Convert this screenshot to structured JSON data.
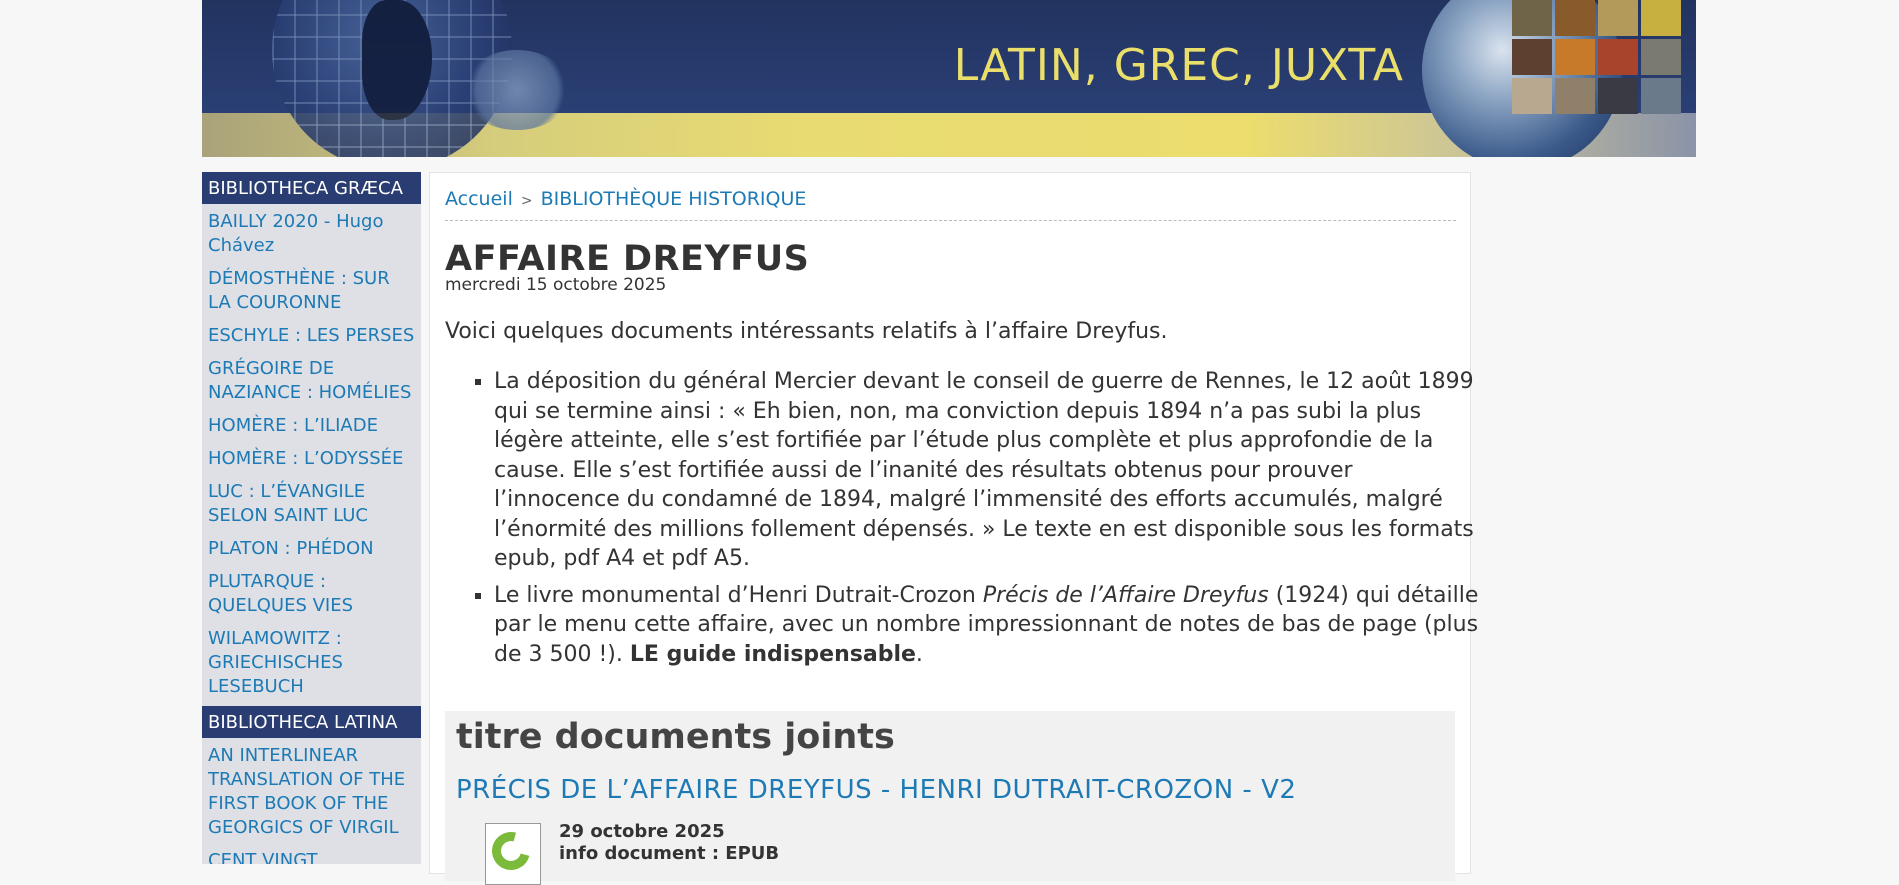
{
  "site": {
    "title": "LATIN, GREC, JUXTA"
  },
  "sidebar": {
    "sections": [
      {
        "heading": "BIBLIOTHECA GRÆCA",
        "items": [
          "BAILLY 2020 - Hugo Chávez",
          "DÉMOSTHÈNE : SUR LA COURONNE",
          "ESCHYLE : LES PERSES",
          "GRÉGOIRE DE NAZIANCE : HOMÉLIES",
          "HOMÈRE : L’ILIADE",
          "HOMÈRE : L’ODYSSÉE",
          "LUC : L’ÉVANGILE SELON SAINT LUC",
          "PLATON : PHÉDON",
          "PLUTARQUE : QUELQUES VIES",
          "WILAMOWITZ : GRIECHISCHES LESEBUCH"
        ]
      },
      {
        "heading": "BIBLIOTHECA LATINA",
        "items": [
          "AN INTERLINEAR TRANSLATION OF THE FIRST BOOK OF THE GEORGICS OF VIRGIL",
          "CENT VINGT VERSIONS"
        ]
      }
    ]
  },
  "breadcrumb": {
    "home": "Accueil",
    "section": "BIBLIOTHÈQUE HISTORIQUE"
  },
  "article": {
    "title": "AFFAIRE DREYFUS",
    "date": "mercredi 15 octobre 2025",
    "intro": "Voici quelques documents intéressants relatifs à l’affaire Dreyfus.",
    "item1": "La déposition du général Mercier devant le conseil de guerre de Rennes, le 12 août 1899 qui se termine ainsi : « Eh bien, non, ma conviction depuis 1894 n’a pas subi la plus légère atteinte, elle s’est fortifiée par l’étude plus complète et plus approfondie de la cause. Elle s’est fortifiée aussi de l’inanité des résultats obtenus pour prouver l’innocence du condamné de 1894, malgré l’immensité des efforts accumulés, malgré l’énormité des millions follement dépensés. » Le texte en est disponible sous les formats epub, pdf A4 et pdf A5.",
    "item2_before": "Le livre monumental d’Henri Dutrait-Crozon ",
    "item2_italic": "Précis de l’Affaire Dreyfus",
    "item2_middle": " (1924) qui détaille par le menu cette affaire, avec un nombre impressionnant de notes de bas de page (plus de 3 500 !). ",
    "item2_bold": "LE guide indispensable",
    "item2_end": "."
  },
  "attachments": {
    "heading": "titre documents joints",
    "doc_title": "PRÉCIS DE L’AFFAIRE DREYFUS - HENRI DUTRAIT-CROZON - V2",
    "doc_date": "29 octobre 2025",
    "doc_info": "info document : EPUB",
    "icon": "epub-icon"
  },
  "colors": {
    "banner_blue": "#2a3f75",
    "banner_yellow": "#eadf6a",
    "link_blue": "#1d7ab5",
    "sidebar_head": "#2a3d73",
    "epub_green": "#7cba3c"
  }
}
